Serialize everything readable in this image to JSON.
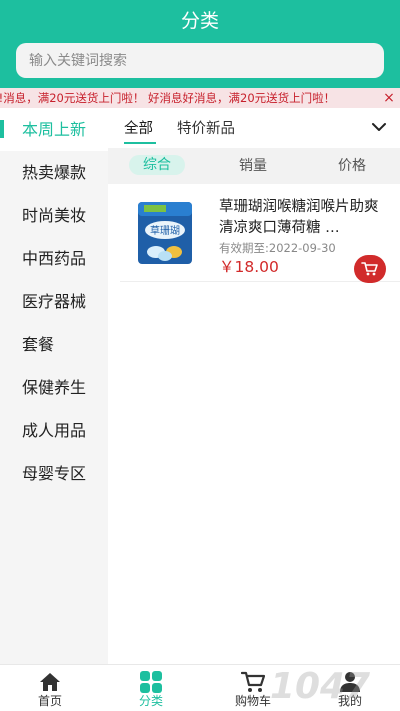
{
  "header": {
    "title": "分类"
  },
  "search": {
    "placeholder": "输入关键词搜索"
  },
  "notice": {
    "text": "!!消息，满20元送货上门啦！ 好消息好消息，满20元送货上门啦！",
    "close_label": "×"
  },
  "sidebar": {
    "items": [
      {
        "label": "本周上新",
        "active": true
      },
      {
        "label": "热卖爆款"
      },
      {
        "label": "时尚美妆"
      },
      {
        "label": "中西药品"
      },
      {
        "label": "医疗器械"
      },
      {
        "label": "套餐"
      },
      {
        "label": "保健养生"
      },
      {
        "label": "成人用品"
      },
      {
        "label": "母婴专区"
      }
    ]
  },
  "filter_tabs": [
    {
      "label": "全部",
      "active": true
    },
    {
      "label": "特价新品"
    }
  ],
  "sort_options": [
    {
      "label": "综合",
      "active": true
    },
    {
      "label": "销量"
    },
    {
      "label": "价格"
    }
  ],
  "product": {
    "name": "草珊瑚润喉糖润喉片助爽 清凉爽口薄荷糖 …",
    "expiry": "有效期至:2022-09-30",
    "price": "￥18.00",
    "image_label": "草珊瑚"
  },
  "bottom_nav": [
    {
      "label": "首页",
      "icon": "home-icon"
    },
    {
      "label": "分类",
      "icon": "category-grid-icon",
      "active": true
    },
    {
      "label": "购物车",
      "icon": "cart-icon"
    },
    {
      "label": "我的",
      "icon": "user-icon"
    }
  ],
  "watermark": {
    "text": "1047"
  },
  "colors": {
    "accent": "#1dbf9f",
    "price": "#d22a2a",
    "notice": "#c7202c"
  }
}
